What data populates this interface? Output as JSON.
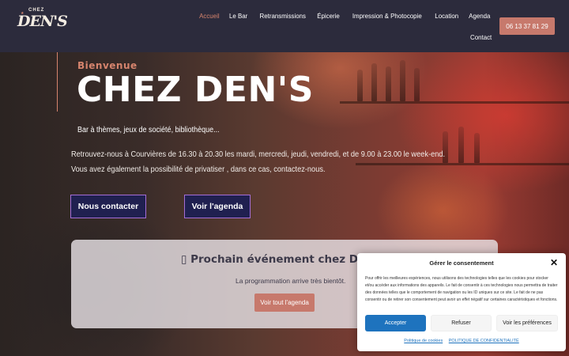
{
  "header": {
    "logo_small": "CHEZ",
    "logo_main": "DEN'S",
    "nav": [
      {
        "label": "Accueil",
        "active": true
      },
      {
        "label": "Le Bar"
      },
      {
        "label": "Retransmissions"
      },
      {
        "label": "Épicerie"
      },
      {
        "label": "Impression & Photocopie"
      },
      {
        "label": "Location"
      },
      {
        "label": "Agenda"
      }
    ],
    "nav_contact": "Contact",
    "phone": "06 13 37 81 29"
  },
  "hero": {
    "kicker": "Bienvenue",
    "title": "CHEZ DEN'S",
    "tagline": "Bar à thèmes, jeux de société, bibliothèque...",
    "paragraph_1": "Retrouvez-nous à Courvières de 16.30 à 20.30 les mardi, mercredi, jeudi, vendredi, et de 9.00 à 23.00 le week-end.",
    "paragraph_2": "Vous avez également la possibilité de privatiser , dans ce cas, contactez-nous.",
    "btn_contact": "Nous contacter",
    "btn_agenda": "Voir l'agenda"
  },
  "event": {
    "title": "▯ Prochain événement chez D",
    "subtitle": "La programmation arrive très bientôt.",
    "button": "Voir tout l'agenda"
  },
  "consent": {
    "title": "Gérer le consentement",
    "text": "Pour offrir les meilleures expériences, nous utilisons des technologies telles que les cookies pour stocker et/ou accéder aux informations des appareils. Le fait de consentir à ces technologies nous permettra de traiter des données telles que le comportement de navigation ou les ID uniques sur ce site. Le fait de ne pas consentir ou de retirer son consentement peut avoir un effet négatif sur certaines caractéristiques et fonctions.",
    "accept": "Accepter",
    "refuse": "Refuser",
    "prefs": "Voir les préférences",
    "link_cookies": "Politique de cookies",
    "link_privacy": "POLITIQUE DE CONFIDENTIALITÉ",
    "close_symbol": "✕"
  },
  "colors": {
    "header_bg": "#2c2b3c",
    "accent": "#d6846d",
    "button_dark": "#202050",
    "button_border": "#a46dd6",
    "consent_accept": "#1e73be"
  }
}
